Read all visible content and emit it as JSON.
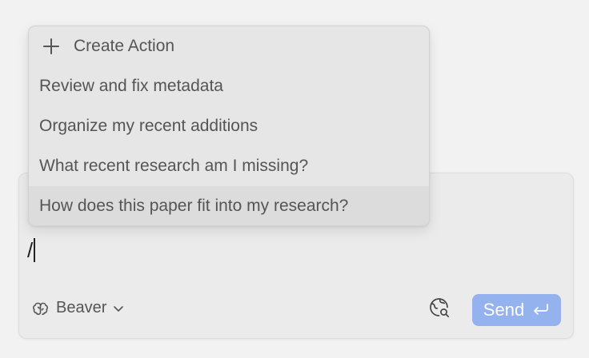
{
  "menu": {
    "create_label": "Create Action",
    "items": [
      {
        "label": "Review and fix metadata"
      },
      {
        "label": "Organize my recent additions"
      },
      {
        "label": "What recent research am I missing?"
      },
      {
        "label": "How does this paper fit into my research?"
      }
    ]
  },
  "composer": {
    "text": "/",
    "model_label": "Beaver",
    "send_label": "Send"
  },
  "colors": {
    "send_bg": "#94b2ee",
    "active_item_bg": "#dcdcdc"
  },
  "icons": {
    "create": "plus-icon",
    "model": "brain-icon",
    "model_dropdown": "chevron-down-icon",
    "web_search": "globe-search-icon",
    "send": "return-icon"
  }
}
